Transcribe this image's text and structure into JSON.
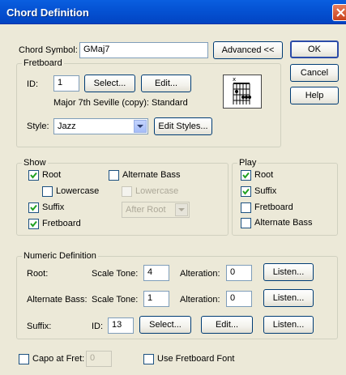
{
  "window": {
    "title": "Chord Definition"
  },
  "chord_symbol": {
    "label": "Chord Symbol:",
    "value": "GMaj7",
    "advanced_button": "Advanced <<"
  },
  "buttons": {
    "ok": "OK",
    "cancel": "Cancel",
    "help": "Help"
  },
  "fretboard": {
    "group_title": "Fretboard",
    "id_label": "ID:",
    "id_value": "1",
    "select_button": "Select...",
    "edit_button": "Edit...",
    "description": "Major 7th Seville  (copy): Standard",
    "style_label": "Style:",
    "style_value": "Jazz",
    "edit_styles_button": "Edit Styles..."
  },
  "show": {
    "group_title": "Show",
    "root": {
      "label": "Root",
      "checked": true
    },
    "lowercase": {
      "label": "Lowercase",
      "checked": false
    },
    "suffix": {
      "label": "Suffix",
      "checked": true
    },
    "fretboard": {
      "label": "Fretboard",
      "checked": true
    },
    "alternate_bass": {
      "label": "Alternate Bass",
      "checked": false
    },
    "alt_lowercase": {
      "label": "Lowercase",
      "checked": false
    },
    "position_value": "After Root"
  },
  "play": {
    "group_title": "Play",
    "root": {
      "label": "Root",
      "checked": true
    },
    "suffix": {
      "label": "Suffix",
      "checked": true
    },
    "fretboard": {
      "label": "Fretboard",
      "checked": false
    },
    "alternate_bass": {
      "label": "Alternate Bass",
      "checked": false
    }
  },
  "numeric": {
    "group_title": "Numeric Definition",
    "root_label": "Root:",
    "alt_bass_label": "Alternate Bass:",
    "suffix_label": "Suffix:",
    "scale_tone_label": "Scale Tone:",
    "alteration_label": "Alteration:",
    "id_label": "ID:",
    "root_scale_tone": "4",
    "root_alteration": "0",
    "alt_scale_tone": "1",
    "alt_alteration": "0",
    "suffix_id": "13",
    "listen_button": "Listen...",
    "select_button": "Select...",
    "edit_button": "Edit..."
  },
  "bottom": {
    "capo_label": "Capo at Fret:",
    "capo_value": "0",
    "use_font_label": "Use Fretboard Font"
  },
  "icons": {
    "close": "close-icon",
    "check": "check-icon",
    "dropdown": "chevron-down-icon",
    "chord": "chord-diagram-icon"
  }
}
